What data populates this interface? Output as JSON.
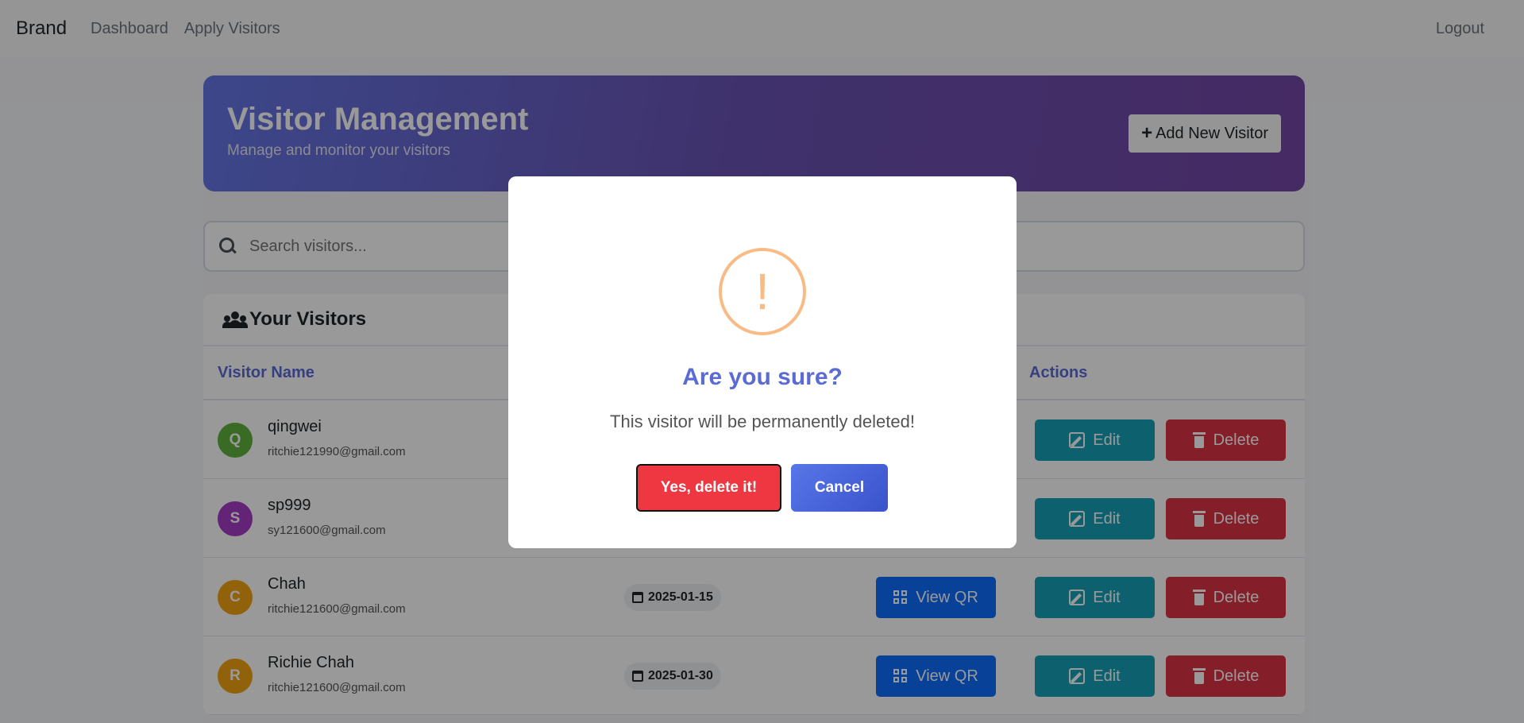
{
  "navbar": {
    "brand": "Brand",
    "links": [
      "Dashboard",
      "Apply Visitors"
    ],
    "logout": "Logout"
  },
  "hero": {
    "title": "Visitor Management",
    "subtitle": "Manage and monitor your visitors",
    "add_button": "Add New Visitor"
  },
  "search": {
    "placeholder": "Search visitors..."
  },
  "visitors_card": {
    "title": "Your Visitors",
    "columns": {
      "name": "Visitor Name",
      "actions": "Actions"
    },
    "rows": [
      {
        "initial": "Q",
        "name": "qingwei",
        "email": "ritchie121990@gmail.com",
        "date": "",
        "avatar_color": "#5fb33f"
      },
      {
        "initial": "S",
        "name": "sp999",
        "email": "sy121600@gmail.com",
        "date": "",
        "avatar_color": "#a63dc6"
      },
      {
        "initial": "C",
        "name": "Chah",
        "email": "ritchie121600@gmail.com",
        "date": "2025-01-15",
        "avatar_color": "#f2a30f"
      },
      {
        "initial": "R",
        "name": "Richie Chah",
        "email": "ritchie121600@gmail.com",
        "date": "2025-01-30",
        "avatar_color": "#f2a30f"
      }
    ],
    "view_qr_label": "View QR",
    "edit_label": "Edit",
    "delete_label": "Delete"
  },
  "modal": {
    "icon": "!",
    "title": "Are you sure?",
    "text": "This visitor will be permanently deleted!",
    "confirm_label": "Yes, delete it!",
    "cancel_label": "Cancel"
  },
  "colors": {
    "primary": "#0d6efd",
    "info": "#17a2b8",
    "danger": "#dc3545",
    "accent": "#5b6bd6",
    "warning_icon": "#f8bb86"
  }
}
